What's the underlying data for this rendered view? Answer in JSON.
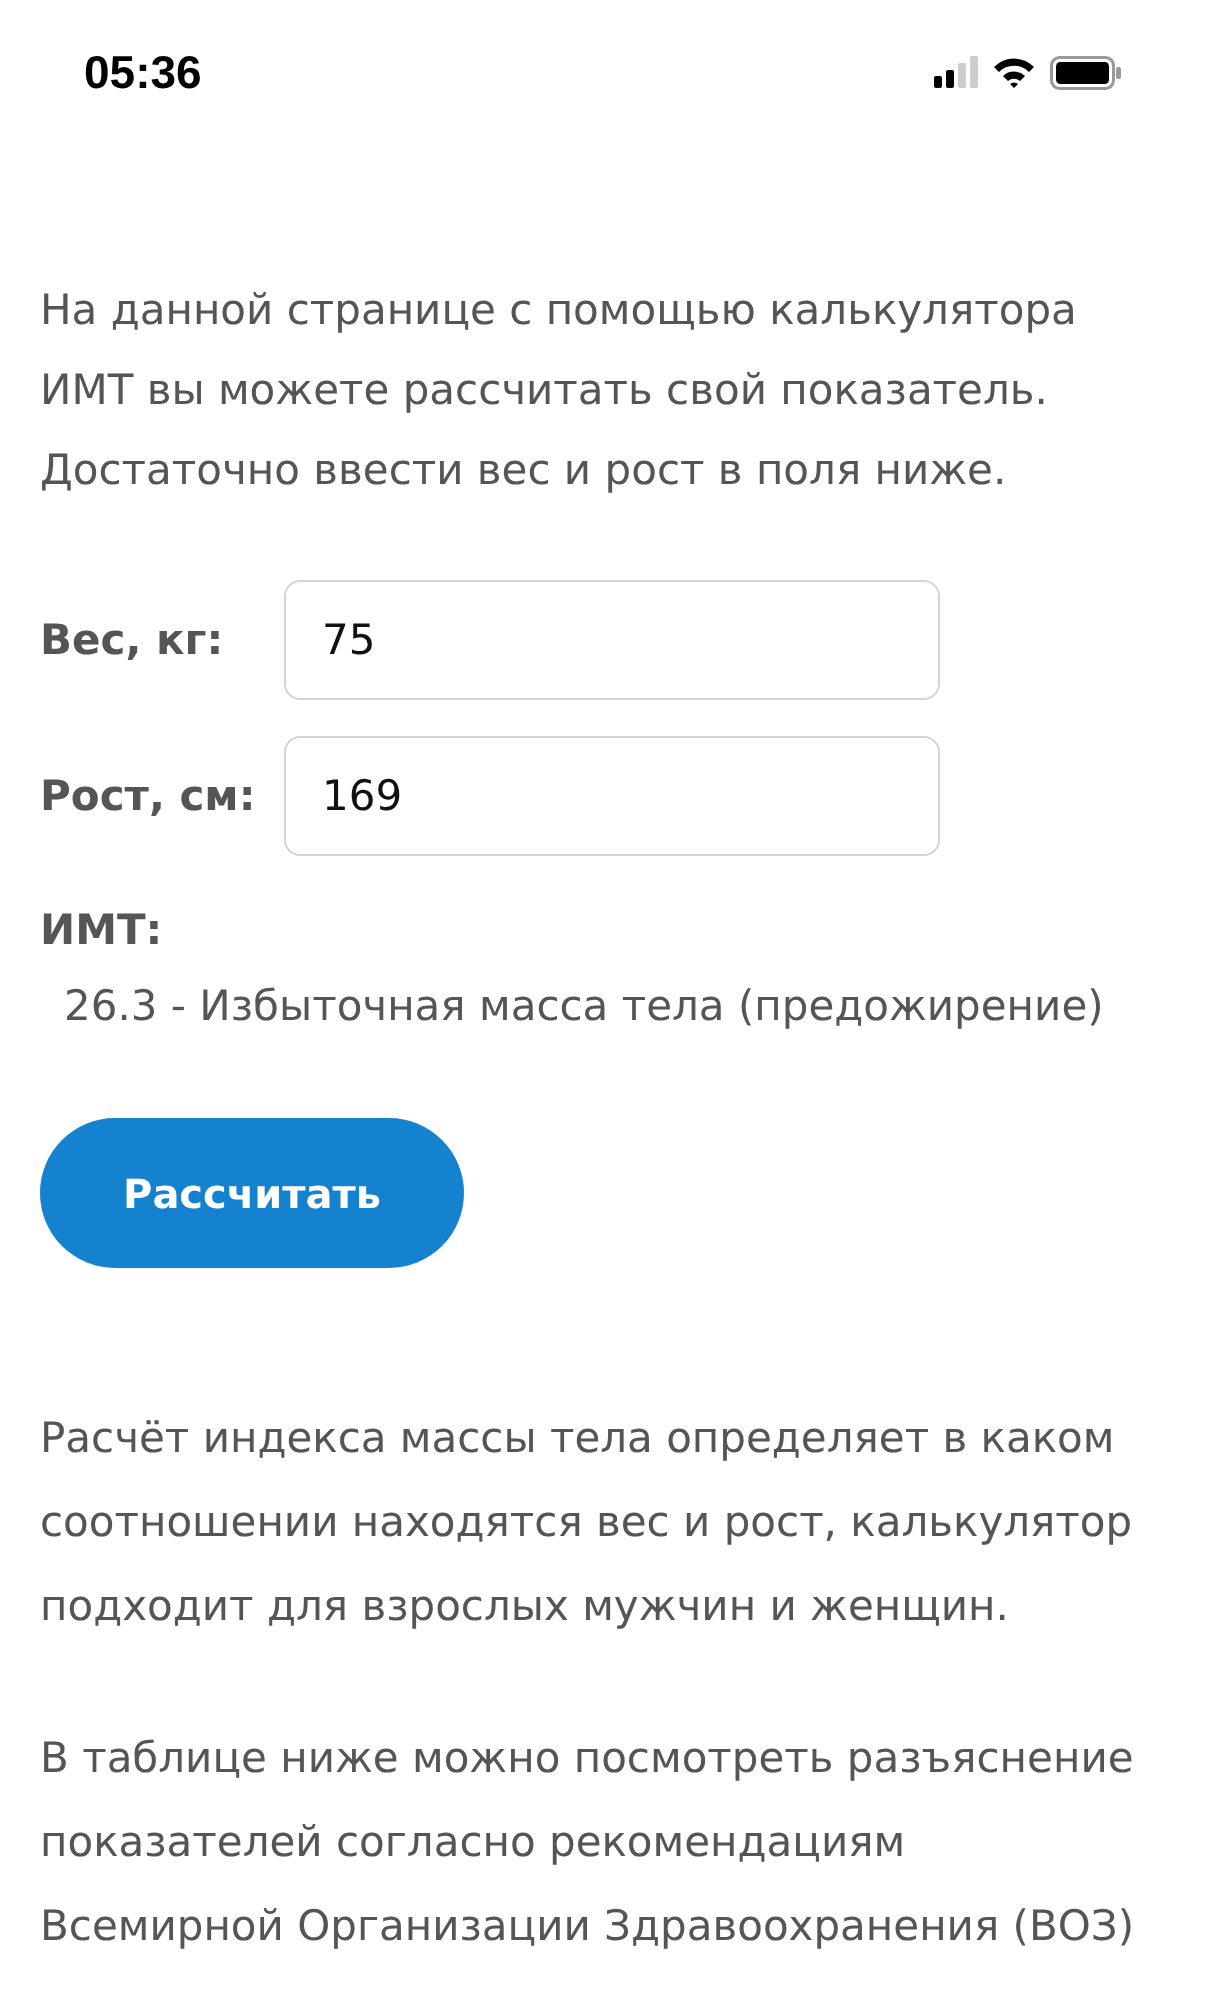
{
  "status_bar": {
    "time": "05:36"
  },
  "intro": "На данной странице с помощью калькулятора\nИМТ вы можете рассчитать свой показатель.\nДостаточно ввести вес и рост в поля ниже.",
  "fields": [
    {
      "label": "Вес, кг:",
      "value": "75"
    },
    {
      "label": "Рост, см:",
      "value": "169"
    }
  ],
  "result": {
    "label": "ИМТ:",
    "value": "26.3 - Избыточная масса тела (предожирение)"
  },
  "button": "Рассчитать",
  "paragraphs": [
    "Расчёт индекса массы тела определяет в каком\nсоотношении находятся вес и рост, калькулятор\nподходит для взрослых мужчин и женщин.",
    "В таблице ниже можно посмотреть разъяснение\nпоказателей согласно рекомендациям\nВсемирной Организации Здравоохранения (ВОЗ)"
  ]
}
